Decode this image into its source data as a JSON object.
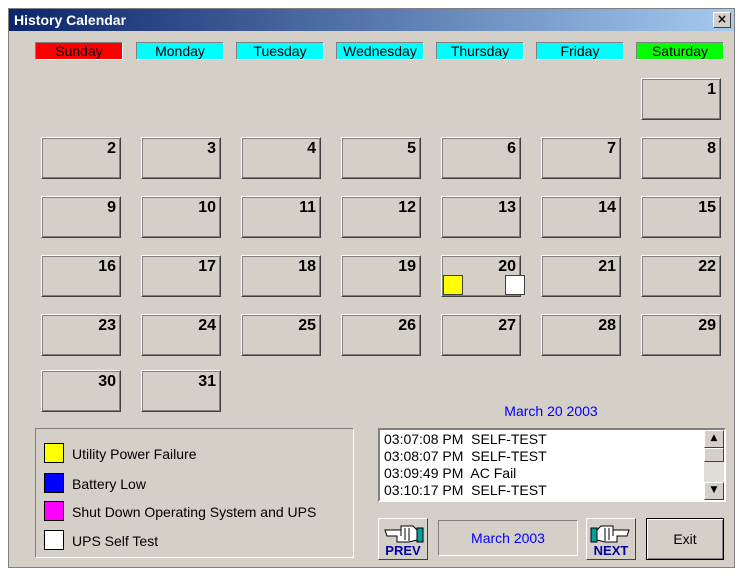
{
  "window": {
    "title": "History Calendar",
    "close_label": "×"
  },
  "days": [
    {
      "label": "Sunday",
      "bg": "#ff0000"
    },
    {
      "label": "Monday",
      "bg": "#00ffff"
    },
    {
      "label": "Tuesday",
      "bg": "#00ffff"
    },
    {
      "label": "Wednesday",
      "bg": "#00ffff"
    },
    {
      "label": "Thursday",
      "bg": "#00ffff"
    },
    {
      "label": "Friday",
      "bg": "#00ffff"
    },
    {
      "label": "Saturday",
      "bg": "#00ff00"
    }
  ],
  "calendar": {
    "first_weekday": 6,
    "day_count": 31,
    "events": {
      "20": [
        "#ffff00",
        "#ffffff"
      ]
    }
  },
  "legend": [
    {
      "label": "Utility Power Failure",
      "color": "#ffff00"
    },
    {
      "label": "Battery Low",
      "color": "#0000ff"
    },
    {
      "label": "Shut Down Operating System and UPS",
      "color": "#ff00ff"
    },
    {
      "label": "UPS Self Test",
      "color": "#ffffff"
    }
  ],
  "selected_date": "March 20 2003",
  "log": [
    "03:07:08 PM  SELF-TEST",
    "03:08:07 PM  SELF-TEST",
    "03:09:49 PM  AC Fail",
    "03:10:17 PM  SELF-TEST"
  ],
  "nav": {
    "prev": "PREV",
    "month": "March 2003",
    "next": "NEXT",
    "exit": "Exit"
  },
  "colors": {
    "title_start": "#0a246a",
    "title_end": "#a6caf0",
    "accent_text": "#0000ff"
  }
}
